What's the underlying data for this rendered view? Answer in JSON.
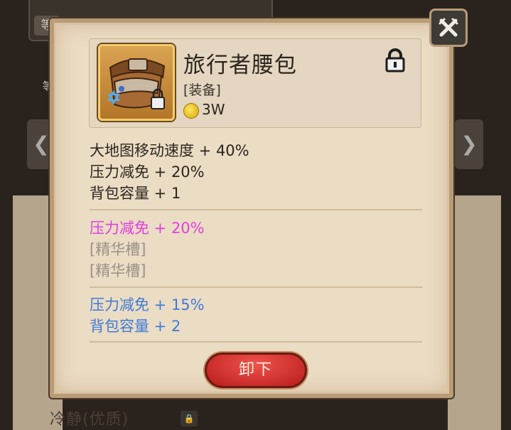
{
  "background": {
    "tab_label": "等",
    "tab2_label": "等",
    "left_arrow": "❮",
    "right_arrow": "❯",
    "bottom_text": "冷静(优质)"
  },
  "item": {
    "name": "旅行者腰包",
    "type": "[装备]",
    "price": "3W"
  },
  "base_stats": [
    "大地图移动速度 + 40%",
    "压力减免 + 20%",
    "背包容量 + 1"
  ],
  "essence": {
    "stat": "压力减免 + 20%",
    "slots": [
      "[精华槽]",
      "[精华槽]"
    ]
  },
  "bonus_stats": [
    "压力减免 + 15%",
    "背包容量 + 2"
  ],
  "buttons": {
    "unequip": "卸下"
  },
  "colors": {
    "base": "#2c2620",
    "essence_stat": "#e23ee0",
    "slot": "#9a9086",
    "bonus": "#3f7bd6",
    "button": "#d93a36"
  }
}
